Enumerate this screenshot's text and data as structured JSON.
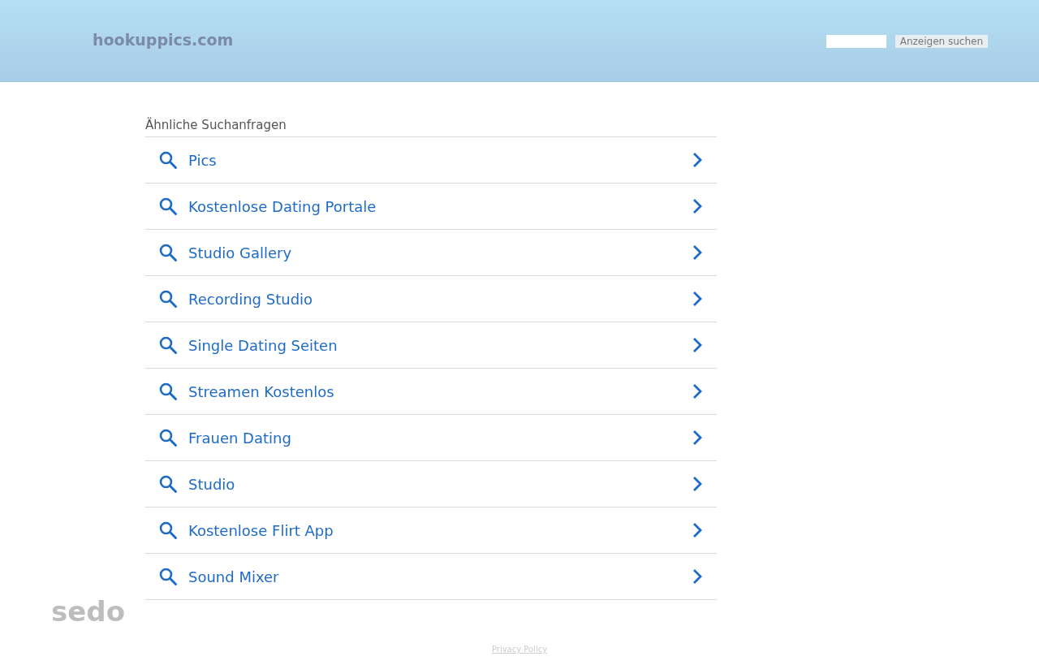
{
  "header": {
    "logo": "hookuppics.com",
    "search_button": "Anzeigen suchen"
  },
  "related": {
    "heading": "Ähnliche Suchanfragen",
    "items": [
      {
        "label": "Pics"
      },
      {
        "label": "Kostenlose Dating Portale"
      },
      {
        "label": "Studio Gallery"
      },
      {
        "label": "Recording Studio"
      },
      {
        "label": "Single Dating Seiten"
      },
      {
        "label": "Streamen Kostenlos"
      },
      {
        "label": "Frauen Dating"
      },
      {
        "label": "Studio"
      },
      {
        "label": "Kostenlose Flirt App"
      },
      {
        "label": "Sound Mixer"
      }
    ]
  },
  "footer": {
    "brand": "sedo",
    "privacy_link": "Privacy Policy"
  }
}
